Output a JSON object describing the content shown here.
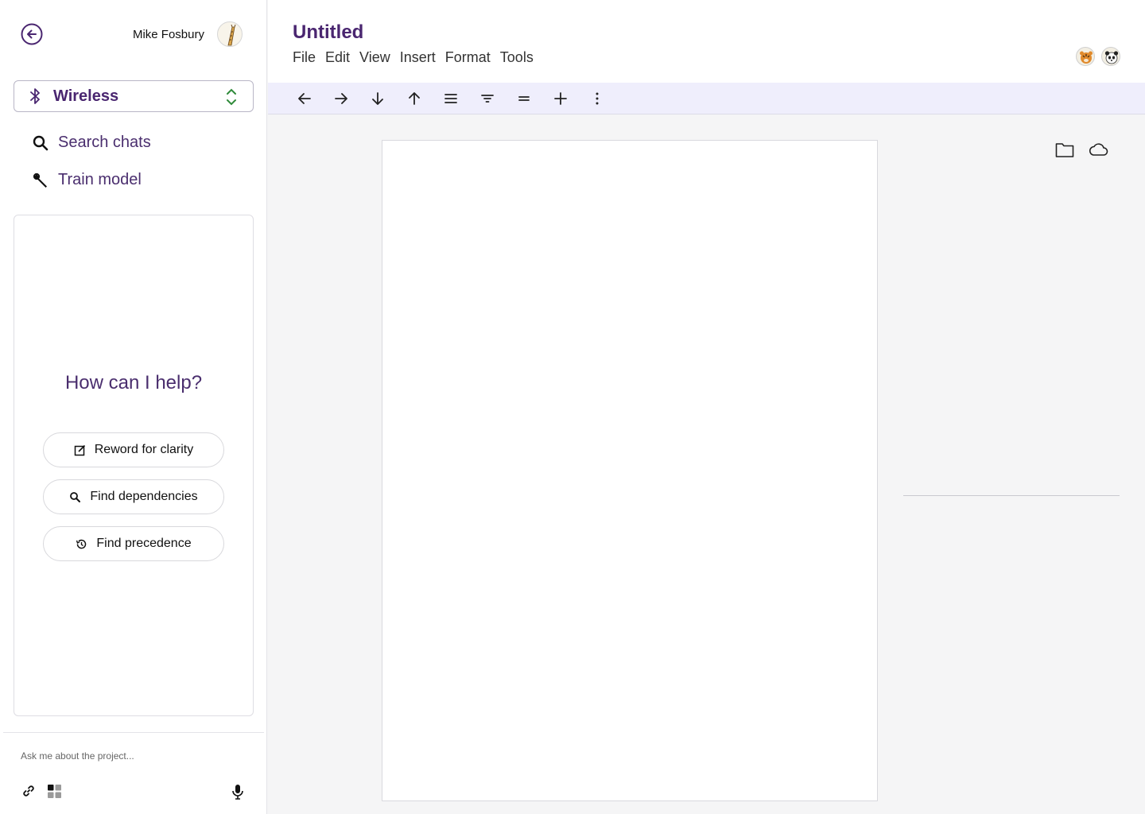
{
  "sidebar": {
    "user": {
      "name": "Mike Fosbury",
      "avatar_icon": "giraffe-avatar"
    },
    "project": {
      "label": "Wireless",
      "icon": "bluetooth-icon"
    },
    "nav": [
      {
        "label": "Search chats",
        "icon": "search-icon"
      },
      {
        "label": "Train model",
        "icon": "wrench-icon"
      }
    ],
    "chat": {
      "prompt": "How can I help?",
      "suggestions": [
        {
          "label": "Reword for clarity",
          "icon": "edit-icon"
        },
        {
          "label": "Find dependencies",
          "icon": "search-icon"
        },
        {
          "label": "Find precedence",
          "icon": "history-icon"
        }
      ]
    },
    "composer": {
      "placeholder": "Ask me about the project..."
    }
  },
  "document": {
    "title": "Untitled",
    "menu": [
      "File",
      "Edit",
      "View",
      "Insert",
      "Format",
      "Tools"
    ],
    "collaborators": [
      "tiger-avatar",
      "panda-avatar"
    ]
  },
  "toolbar": {
    "buttons": [
      "arrow-left-icon",
      "arrow-right-icon",
      "arrow-down-icon",
      "arrow-up-icon",
      "align-justify-icon",
      "filter-icon",
      "equal-icon",
      "plus-icon",
      "more-vertical-icon"
    ]
  },
  "colors": {
    "accent": "#4a2670",
    "toolbar_bg": "#efeefc",
    "chevron": "#2f8a3a"
  }
}
